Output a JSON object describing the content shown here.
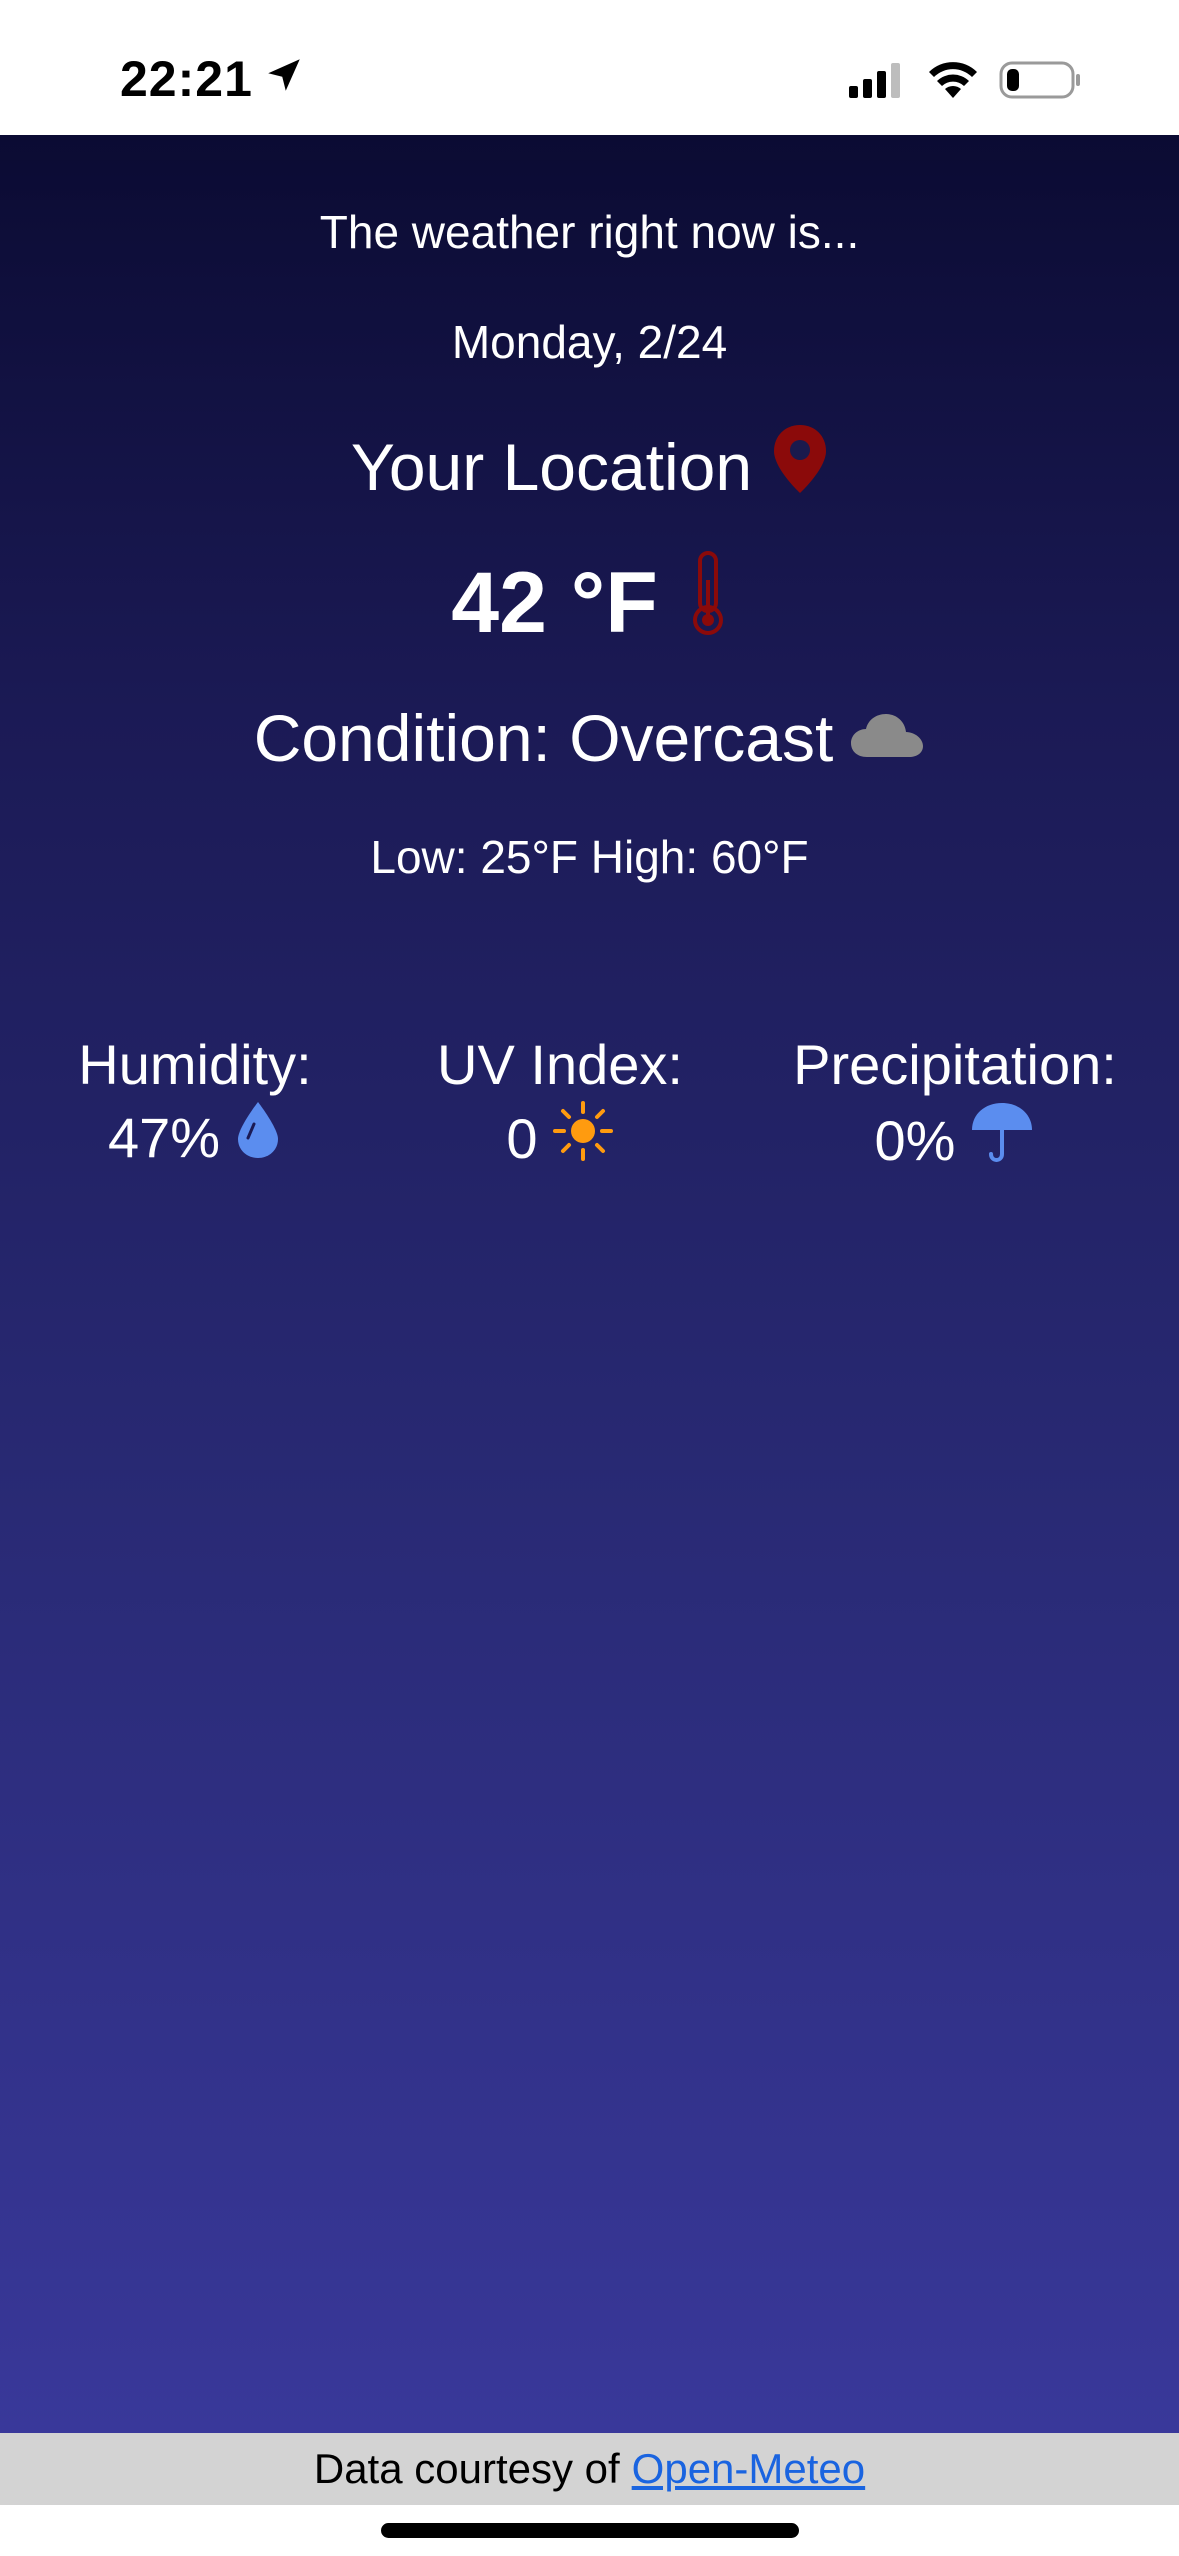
{
  "status_bar": {
    "time": "22:21",
    "battery_level": 0.2
  },
  "weather": {
    "intro": "The weather right now is...",
    "date": "Monday, 2/24",
    "location": "Your Location",
    "temperature": "42 °F",
    "condition": "Condition: Overcast",
    "low_high": "Low: 25°F High: 60°F"
  },
  "stats": {
    "humidity": {
      "label": "Humidity:",
      "value": "47%"
    },
    "uv": {
      "label": "UV Index:",
      "value": "0"
    },
    "precipitation": {
      "label": "Precipitation:",
      "value": "0%"
    }
  },
  "footer": {
    "prefix": "Data courtesy of",
    "link_text": "Open-Meteo"
  },
  "icons": {
    "location": "map-pin-icon",
    "temperature": "thermometer-icon",
    "condition": "cloud-icon",
    "humidity": "water-drop-icon",
    "uv": "sun-icon",
    "precipitation": "umbrella-icon"
  },
  "colors": {
    "accent_red": "#8b0a0a",
    "cloud_gray": "#8a8a8a",
    "drop_blue": "#5b8def",
    "sun_orange": "#ff9b0f",
    "link_blue": "#1a64e0",
    "footer_bg": "#d3d3d3"
  }
}
